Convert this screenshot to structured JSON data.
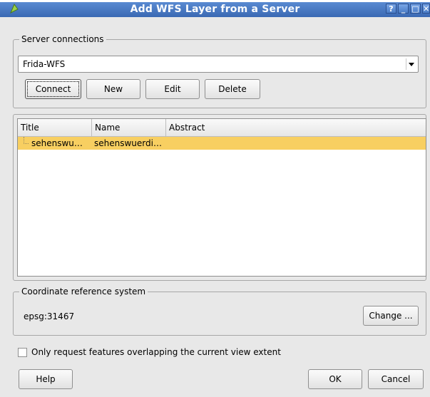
{
  "window": {
    "title": "Add WFS Layer from a Server",
    "controls": {
      "help": "?",
      "minimize": "_",
      "maximize": "□",
      "close": "✕"
    }
  },
  "server_connections": {
    "label": "Server connections",
    "selected": "Frida-WFS",
    "buttons": {
      "connect": "Connect",
      "new": "New",
      "edit": "Edit",
      "delete": "Delete"
    }
  },
  "layers_table": {
    "columns": [
      "Title",
      "Name",
      "Abstract"
    ],
    "rows": [
      {
        "title": "sehenswu…",
        "name": "sehenswuerdi…",
        "abstract": ""
      }
    ]
  },
  "crs": {
    "label": "Coordinate reference system",
    "value": "epsg:31467",
    "change_button": "Change ..."
  },
  "options": {
    "extent_checkbox_label": "Only request features overlapping the current view extent",
    "extent_checked": false
  },
  "footer": {
    "help": "Help",
    "ok": "OK",
    "cancel": "Cancel"
  },
  "colors": {
    "titlebar": "#4a7cc6",
    "selected_row": "#f8cf61"
  }
}
